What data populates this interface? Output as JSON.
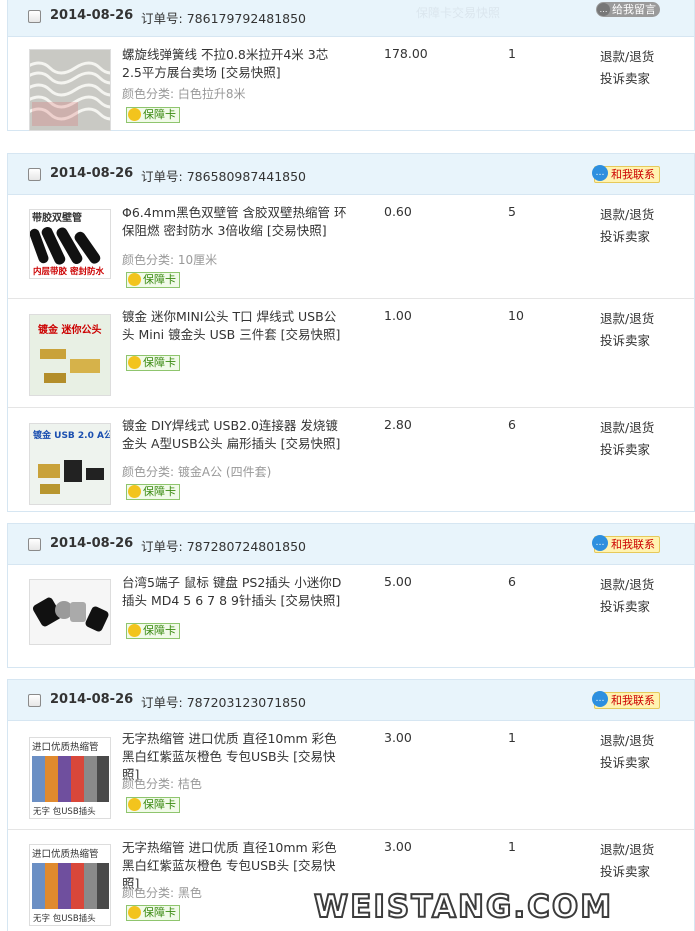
{
  "orders": [
    {
      "date": "2014-08-26",
      "label": "订单号:",
      "number": "786179792481850",
      "action": "给我留言",
      "faded": "保障卡交易快照",
      "items": [
        {
          "title": "螺旋线弹簧线 不拉0.8米拉开4米 3芯2.5平方展台卖场 [交易快照]",
          "sku": "颜色分类: 白色拉升8米",
          "guarantee": "保障卡",
          "price": "178.00",
          "qty": "1",
          "refund": "退款/退货",
          "complain": "投诉卖家",
          "img": "coil"
        }
      ]
    },
    {
      "date": "2014-08-26",
      "label": "订单号:",
      "number": "786580987441850",
      "action": "和我联系",
      "items": [
        {
          "title": "Φ6.4mm黑色双壁管 含胶双壁热缩管 环保阻燃 密封防水 3倍收缩 [交易快照]",
          "sku": "颜色分类: 10厘米",
          "guarantee": "保障卡",
          "price": "0.60",
          "qty": "5",
          "refund": "退款/退货",
          "complain": "投诉卖家",
          "img": "tube",
          "img_top_text": "带胶双壁管",
          "img_bottom_text": "内层带胶 密封防水"
        },
        {
          "title": "镀金 迷你MINI公头 T口 焊线式 USB公头 Mini 镀金头 USB 三件套 [交易快照]",
          "sku": "",
          "guarantee": "保障卡",
          "price": "1.00",
          "qty": "10",
          "refund": "退款/退货",
          "complain": "投诉卖家",
          "img": "mini",
          "img_top_text": "镀金 迷你公头"
        },
        {
          "title": "镀金 DIY焊线式 USB2.0连接器 发烧镀金头 A型USB公头 扁形插头 [交易快照]",
          "sku": "颜色分类: 镀金A公 (四件套)",
          "guarantee": "保障卡",
          "price": "2.80",
          "qty": "6",
          "refund": "退款/退货",
          "complain": "投诉卖家",
          "img": "usba",
          "img_top_text": "镀金 USB 2.0 A公"
        }
      ]
    },
    {
      "date": "2014-08-26",
      "label": "订单号:",
      "number": "787280724801850",
      "action": "和我联系",
      "items": [
        {
          "title": "台湾5端子 鼠标 键盘 PS2插头 小迷你D插头 MD4 5 6 7 8 9针插头 [交易快照]",
          "sku": "",
          "guarantee": "保障卡",
          "price": "5.00",
          "qty": "6",
          "refund": "退款/退货",
          "complain": "投诉卖家",
          "img": "din"
        }
      ]
    },
    {
      "date": "2014-08-26",
      "label": "订单号:",
      "number": "787203123071850",
      "action": "和我联系",
      "items": [
        {
          "title": "无字热缩管 进口优质 直径10mm 彩色黑白红紫蓝灰橙色 专包USB头 [交易快照]",
          "sku": "颜色分类: 桔色",
          "guarantee": "保障卡",
          "price": "3.00",
          "qty": "1",
          "refund": "退款/退货",
          "complain": "投诉卖家",
          "img": "color",
          "img_top_text": "进口优质热缩管",
          "img_bottom_text": "无字 包USB插头"
        },
        {
          "title": "无字热缩管 进口优质 直径10mm 彩色黑白红紫蓝灰橙色 专包USB头 [交易快照]",
          "sku": "颜色分类: 黑色",
          "guarantee": "保障卡",
          "price": "3.00",
          "qty": "1",
          "refund": "退款/退货",
          "complain": "投诉卖家",
          "img": "color",
          "img_top_text": "进口优质热缩管",
          "img_bottom_text": "无字 包USB插头"
        }
      ]
    }
  ],
  "watermark": "WEISTANG.COM",
  "colors": {
    "header_bg": "#e8f4fb",
    "border": "#d6e6f2",
    "link_red": "#cc0000",
    "guarantee_green": "#3a8a12"
  }
}
